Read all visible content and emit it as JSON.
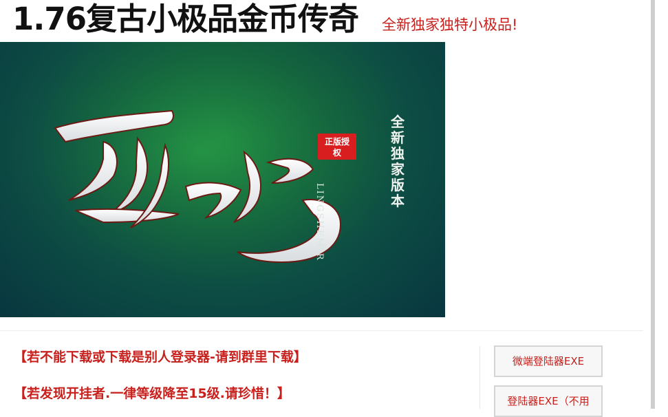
{
  "header": {
    "title": "1.76复古小极品金币传奇",
    "subtitle": "全新独家独特小极品!"
  },
  "banner": {
    "calligraphy": "灵蛇",
    "seal_text": "正版授权",
    "latin_name": "LINGSHEMIR",
    "vertical_tag": "全新独家版本",
    "colors": {
      "bg_top": "#1f8a3e",
      "bg_bottom": "#08363f",
      "seal": "#d81e1e",
      "brush": "#f2f2f2"
    }
  },
  "notices": [
    "【若不能下载或下载是别人登录器-请到群里下载】",
    "【若发现开挂者.一律等级降至15级.请珍惜！】"
  ],
  "downloads": [
    {
      "label": "微端登陆器EXE"
    },
    {
      "label": "登陆器EXE（不用"
    }
  ],
  "colors": {
    "accent": "#c8201c",
    "title": "#111111"
  }
}
